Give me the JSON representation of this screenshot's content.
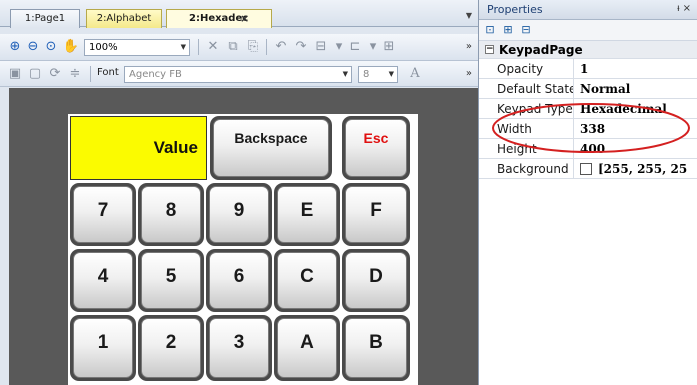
{
  "tabs": [
    {
      "label": "1:Page1"
    },
    {
      "label": "2:Alphabet"
    },
    {
      "label": "2:Hexadec",
      "close": "×"
    }
  ],
  "toolbar1": {
    "zoom_value": "100%",
    "icons": [
      "zoom-in",
      "zoom-out",
      "zoom-fit",
      "pan",
      "cut",
      "copy",
      "paste",
      "undo",
      "redo",
      "align",
      "distribute",
      "grid"
    ]
  },
  "toolbar2": {
    "font_label": "Font",
    "font_value": "Agency FB",
    "font_size": "8"
  },
  "keypad": {
    "value_label": "Value",
    "backspace": "Backspace",
    "esc": "Esc",
    "rows": [
      [
        "7",
        "8",
        "9",
        "E",
        "F"
      ],
      [
        "4",
        "5",
        "6",
        "C",
        "D"
      ],
      [
        "1",
        "2",
        "3",
        "A",
        "B"
      ]
    ]
  },
  "properties": {
    "title": "Properties",
    "pin": "ᵼ ×",
    "category": "KeypadPage",
    "rows": [
      {
        "name": "Opacity",
        "value": "1"
      },
      {
        "name": "Default State",
        "value": "Normal"
      },
      {
        "name": "Keypad Type",
        "value": "Hexadecimal"
      },
      {
        "name": "Width",
        "value": "338"
      },
      {
        "name": "Height",
        "value": "400"
      },
      {
        "name": "Background",
        "value": "[255, 255, 25"
      }
    ]
  },
  "colors": {
    "value_bg": "#fbfb00",
    "esc_text": "#e01010",
    "annotation": "#d42020"
  }
}
